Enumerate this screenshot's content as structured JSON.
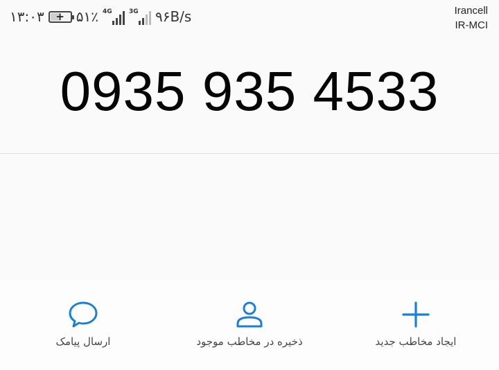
{
  "status_bar": {
    "time": "۱۳:۰۳",
    "battery_percent": "۵۱٪",
    "battery_level": 0.51,
    "battery_charging": true,
    "sim1_tech": "4G",
    "sim2_tech": "3G",
    "data_speed": "۹۶B/s",
    "carrier_1": "Irancell",
    "carrier_2": "IR-MCI"
  },
  "phone_number": "0935 935 4533",
  "actions": {
    "send_sms": {
      "label": "ارسال پیامک",
      "icon": "chat-bubble-icon"
    },
    "save_to_existing": {
      "label": "ذخیره در مخاطب موجود",
      "icon": "person-icon"
    },
    "create_contact": {
      "label": "ایجاد مخاطب جدید",
      "icon": "plus-icon"
    }
  },
  "colors": {
    "accent": "#1a7fd9",
    "background": "#fafafa",
    "divider": "#dedede"
  }
}
